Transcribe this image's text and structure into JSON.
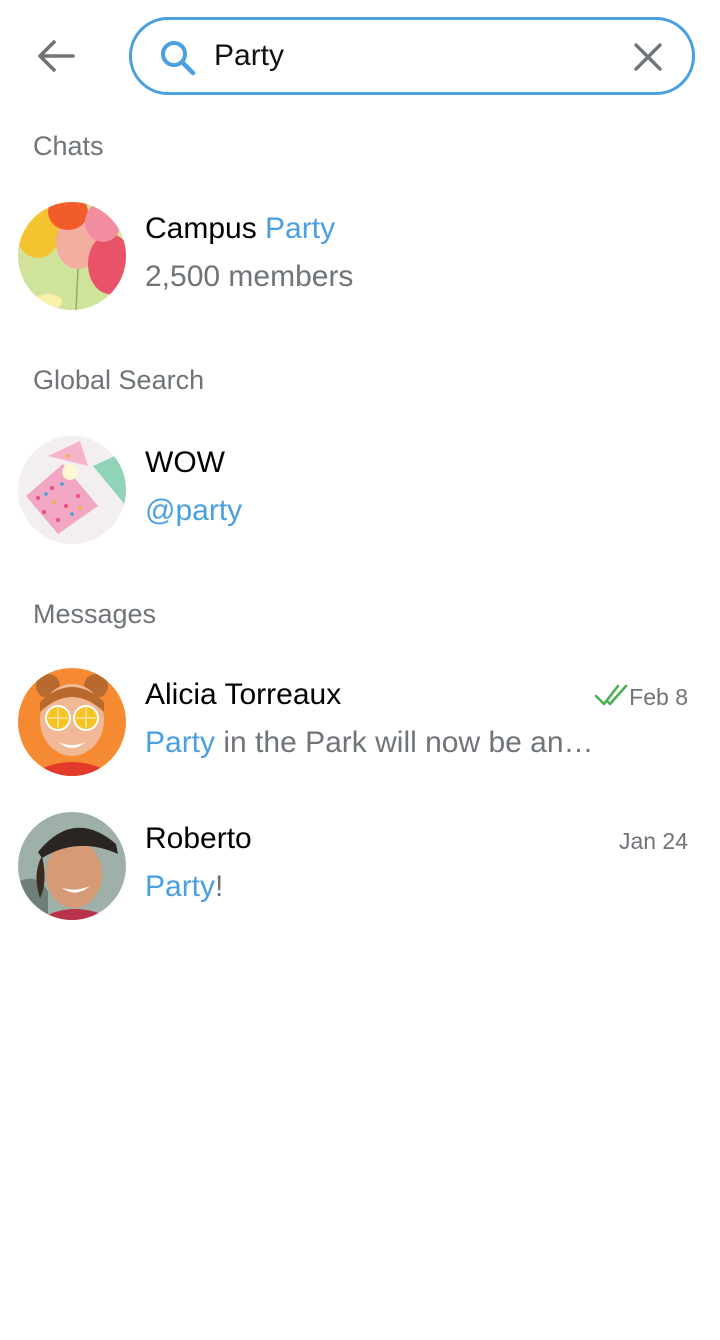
{
  "search": {
    "query": "Party"
  },
  "sections": {
    "chats": "Chats",
    "global": "Global Search",
    "messages": "Messages"
  },
  "chats": [
    {
      "title_prefix": "Campus ",
      "title_highlight": "Party",
      "subtitle": "2,500 members",
      "avatar": "balloons-avatar"
    }
  ],
  "global": [
    {
      "title": "WOW",
      "handle": "@party",
      "avatar": "confetti-cake-avatar"
    }
  ],
  "messages": [
    {
      "name": "Alicia Torreaux",
      "highlight": "Party",
      "rest": " in the Park will now be an…",
      "date": "Feb 8",
      "read_status": "double-check-icon",
      "avatar": "alicia-avatar"
    },
    {
      "name": "Roberto",
      "highlight": "Party",
      "rest": "!",
      "date": "Jan 24",
      "avatar": "roberto-avatar"
    }
  ],
  "colors": {
    "accent": "#4a9fe0",
    "secondary_text": "#6f7479",
    "read_check": "#4caf50"
  }
}
